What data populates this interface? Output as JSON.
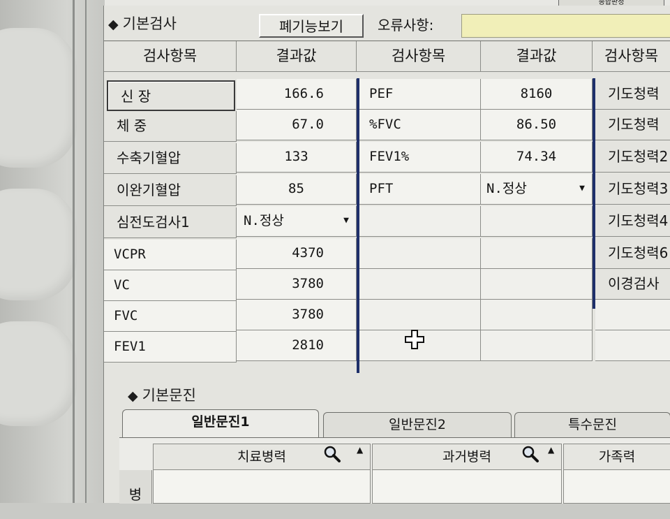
{
  "top_button": "종합판정",
  "basic": {
    "title": "기본검사",
    "disabled_view_btn": "폐기능보기",
    "error_label": "오류사항:",
    "headers": [
      "검사항목",
      "결과값",
      "검사항목",
      "결과값",
      "검사항목"
    ],
    "col1": [
      {
        "item": "신 장",
        "value": "166.6"
      },
      {
        "item": "체 중",
        "value": "67.0"
      },
      {
        "item": "수축기혈압",
        "value": "133"
      },
      {
        "item": "이완기혈압",
        "value": "85"
      },
      {
        "item": "심전도검사1",
        "value": "N.정상"
      },
      {
        "item": "VCPR",
        "value": "4370"
      },
      {
        "item": "VC",
        "value": "3780"
      },
      {
        "item": "FVC",
        "value": "3780"
      },
      {
        "item": "FEV1",
        "value": "2810"
      }
    ],
    "col2": [
      {
        "item": "PEF",
        "value": "8160"
      },
      {
        "item": "%FVC",
        "value": "86.50"
      },
      {
        "item": "FEV1%",
        "value": "74.34"
      },
      {
        "item": "PFT",
        "value": "N.정상"
      }
    ],
    "col3": [
      "기도청력",
      "기도청력",
      "기도청력2",
      "기도청력3",
      "기도청력4",
      "기도청력6",
      "이경검사"
    ]
  },
  "questionnaire": {
    "title": "기본문진",
    "tabs": [
      "일반문진1",
      "일반문진2",
      "특수문진"
    ],
    "sub_headers": [
      "치료병력",
      "과거병력",
      "가족력"
    ],
    "row_label": "병"
  },
  "colors": {
    "accent_line": "#1e2f6a",
    "error_field": "#f1efb8"
  }
}
